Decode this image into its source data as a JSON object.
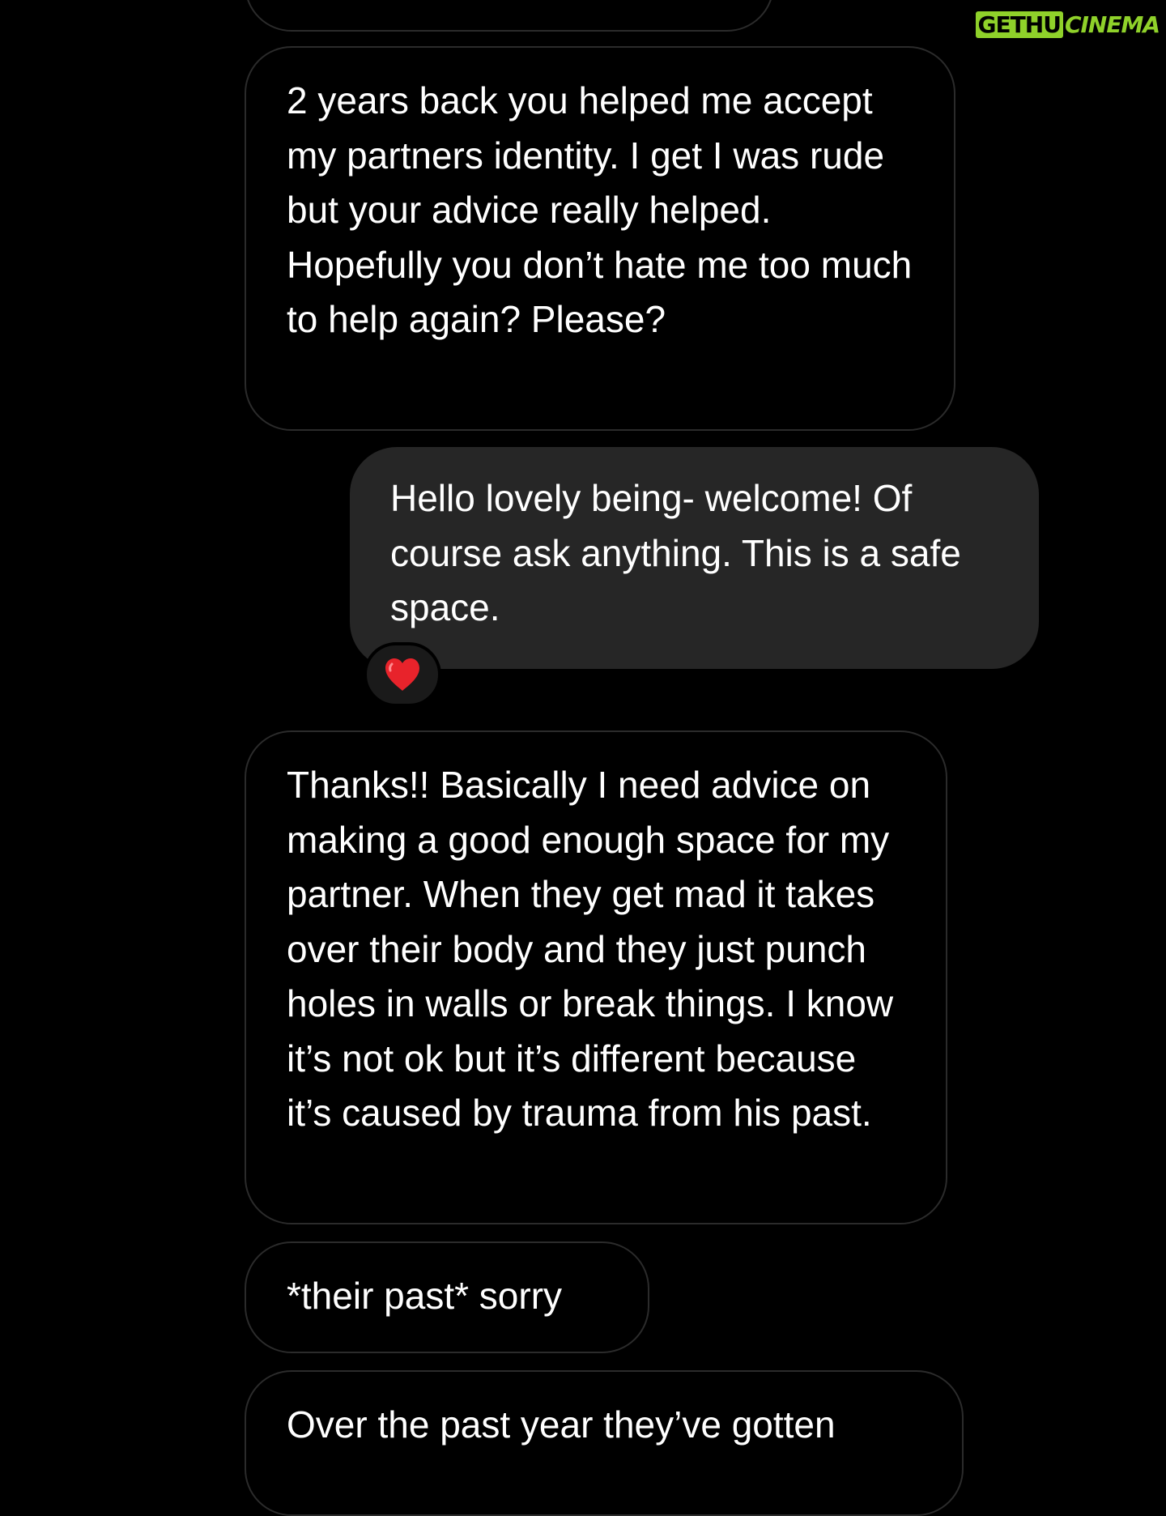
{
  "watermark": {
    "part1": "GETHU",
    "part2": "CINEMA",
    "accent_color": "#8fd12a"
  },
  "messages": [
    {
      "direction": "incoming",
      "text": "2 years back you helped me accept my partners identity. I get I was rude but your advice really helped. Hopefully you don’t hate me too much to help again? Please?"
    },
    {
      "direction": "outgoing",
      "text": "Hello lovely being- welcome! Of course ask anything. This is a safe space.",
      "reaction": "heart-icon"
    },
    {
      "direction": "incoming",
      "text": "Thanks!! Basically I need advice on making a good enough space for my partner. When they get mad it takes over their body and they just punch holes in walls or break things. I know it’s not ok but it’s different because it’s caused by trauma from his past."
    },
    {
      "direction": "incoming",
      "text": "*their past* sorry"
    },
    {
      "direction": "incoming",
      "text": "Over the past year they’ve gotten"
    }
  ],
  "colors": {
    "background": "#000000",
    "incoming_border": "#2b2b2b",
    "outgoing_fill": "#262626",
    "text": "#ffffff",
    "reaction": "#e8232b"
  }
}
